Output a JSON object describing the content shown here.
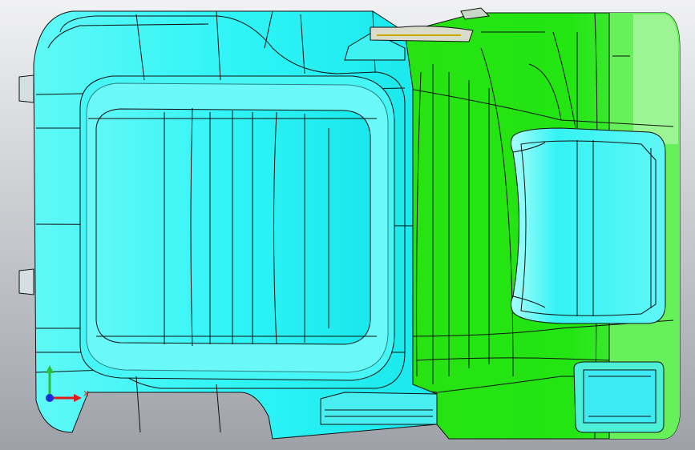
{
  "viewport": {
    "background_top": "#f0f1f3",
    "background_bottom": "#9ea2a8"
  },
  "model": {
    "seat_cushion_color": "#2ff4f6",
    "seat_cushion_highlight": "#8ffcfb",
    "seat_back_color": "#22e512",
    "seat_back_highlight": "#84f57a",
    "edge_color": "#111111"
  },
  "triad": {
    "x_label": "X",
    "y_label": "",
    "x_color": "#e01a1a",
    "y_color": "#29c03a",
    "z_color": "#1b2ddb"
  }
}
